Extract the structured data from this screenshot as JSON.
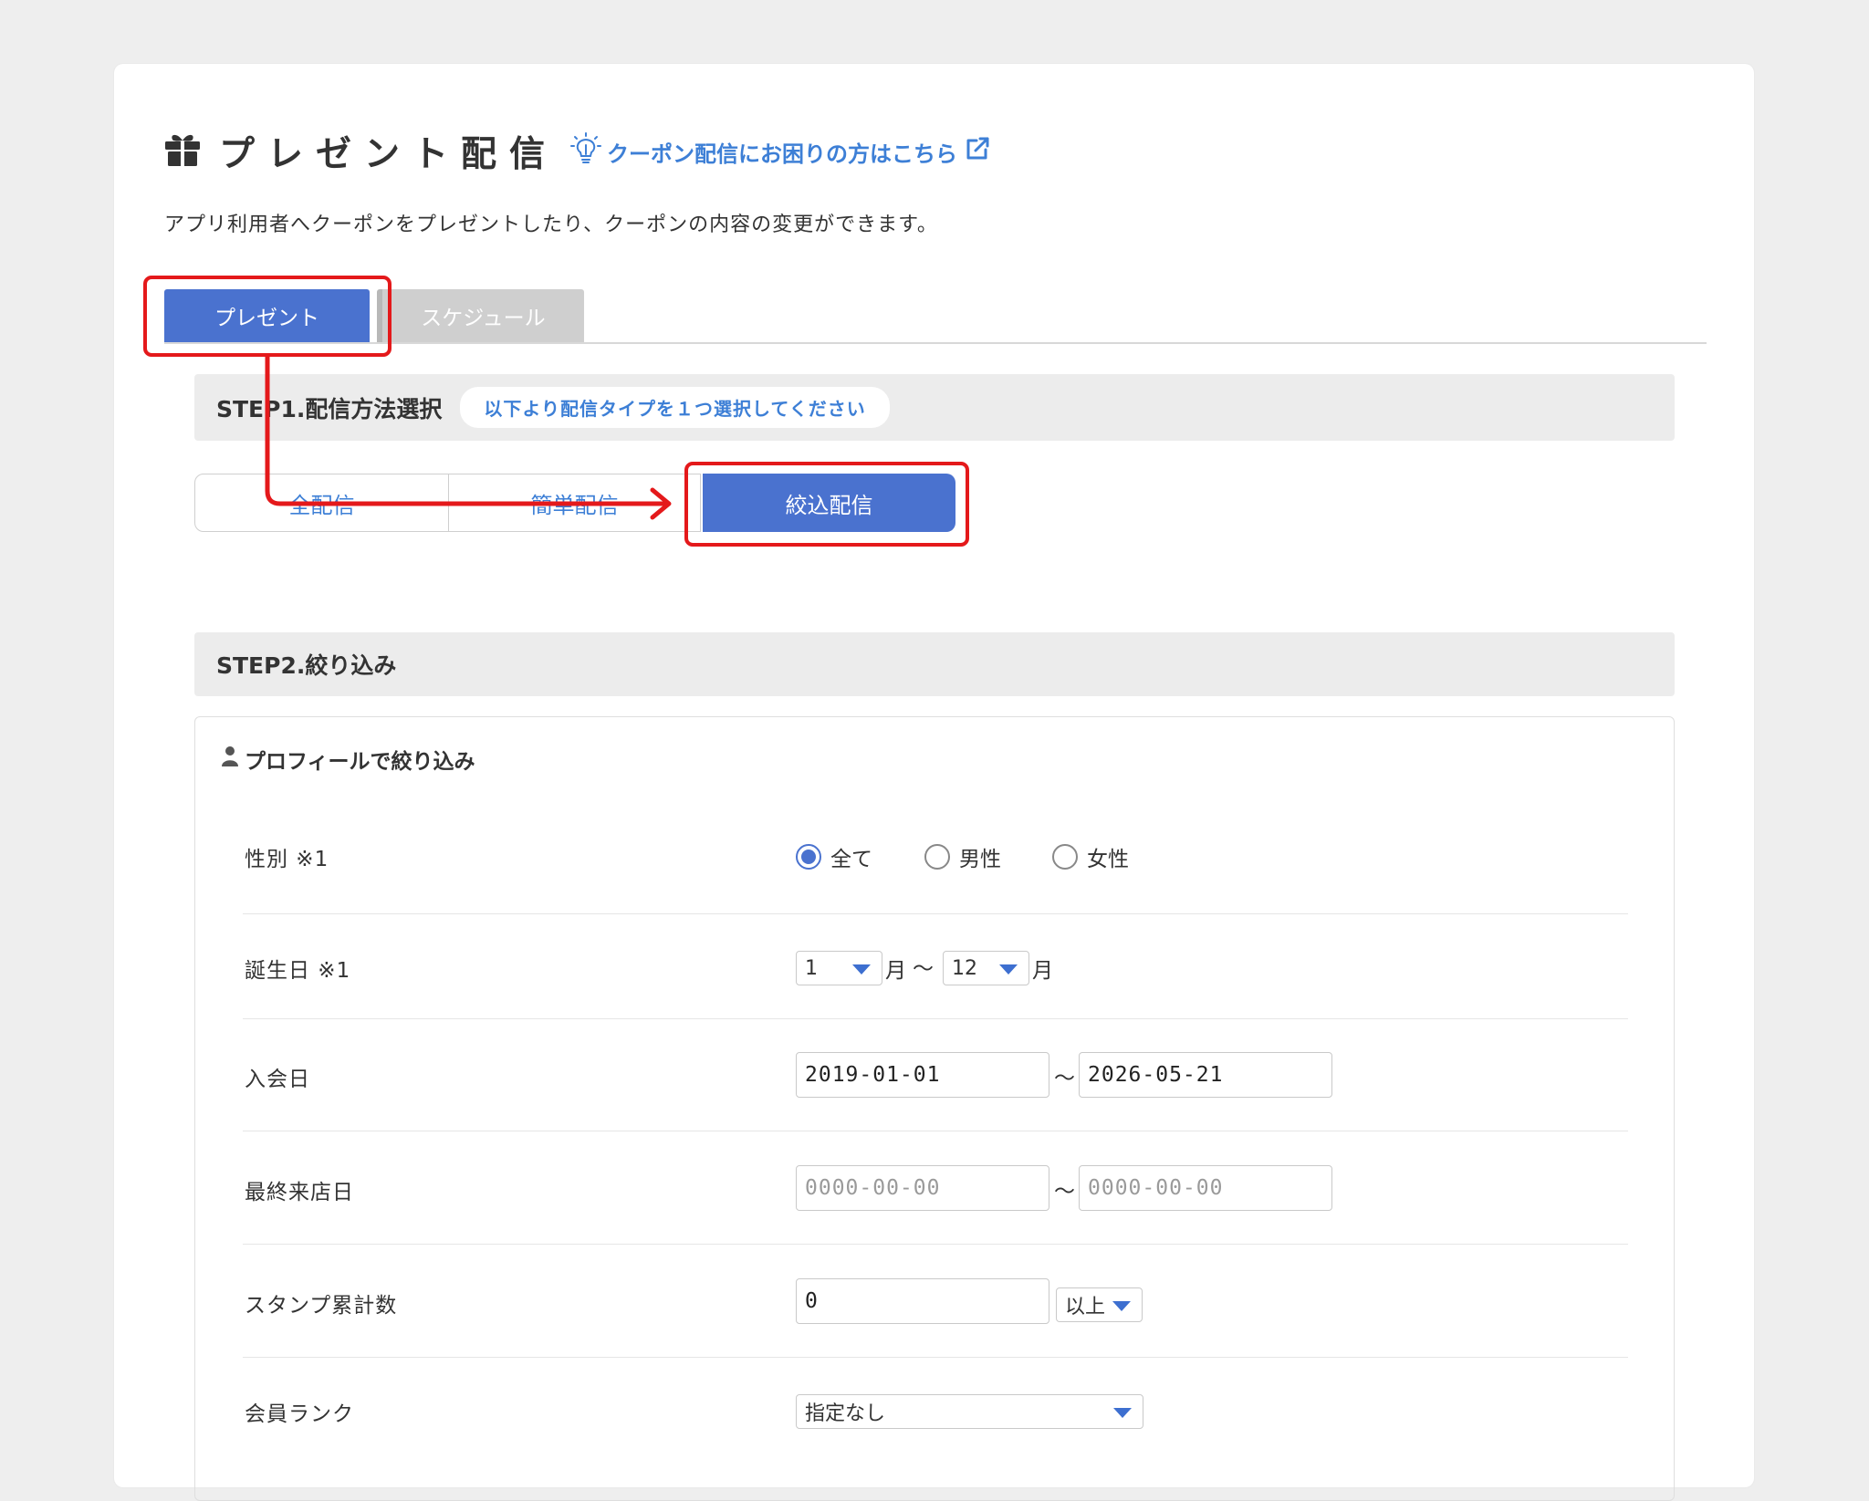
{
  "header": {
    "title": "プレゼント配信",
    "help_link": "クーポン配信にお困りの方はこちら",
    "subtitle": "アプリ利用者へクーポンをプレゼントしたり、クーポンの内容の変更ができます。"
  },
  "tabs": [
    {
      "label": "プレゼント",
      "active": true
    },
    {
      "label": "スケジュール",
      "active": false
    }
  ],
  "step1": {
    "title": "STEP1.配信方法選択",
    "hint": "以下より配信タイプを１つ選択してください",
    "options": [
      {
        "label": "全配信",
        "active": false
      },
      {
        "label": "簡単配信",
        "active": false
      },
      {
        "label": "絞込配信",
        "active": true
      }
    ]
  },
  "step2": {
    "title": "STEP2.絞り込み",
    "panel_title": "プロフィールで絞り込み",
    "gender": {
      "label": "性別 ※1",
      "options": [
        "全て",
        "男性",
        "女性"
      ],
      "selected": "全て"
    },
    "birthday": {
      "label": "誕生日 ※1",
      "from": "1",
      "to": "12",
      "month_suffix": "月",
      "sep": "〜"
    },
    "join_date": {
      "label": "入会日",
      "from": "2019-01-01",
      "to": "2026-05-21",
      "sep": "〜"
    },
    "last_visit": {
      "label": "最終来店日",
      "from_placeholder": "0000-00-00",
      "to_placeholder": "0000-00-00",
      "sep": "〜"
    },
    "stamp_total": {
      "label": "スタンプ累計数",
      "value": "0",
      "condition": "以上"
    },
    "member_rank": {
      "label": "会員ランク",
      "value": "指定なし"
    }
  },
  "colors": {
    "primary": "#4a72cf",
    "link": "#3d7fd6",
    "highlight": "#e4191b"
  }
}
